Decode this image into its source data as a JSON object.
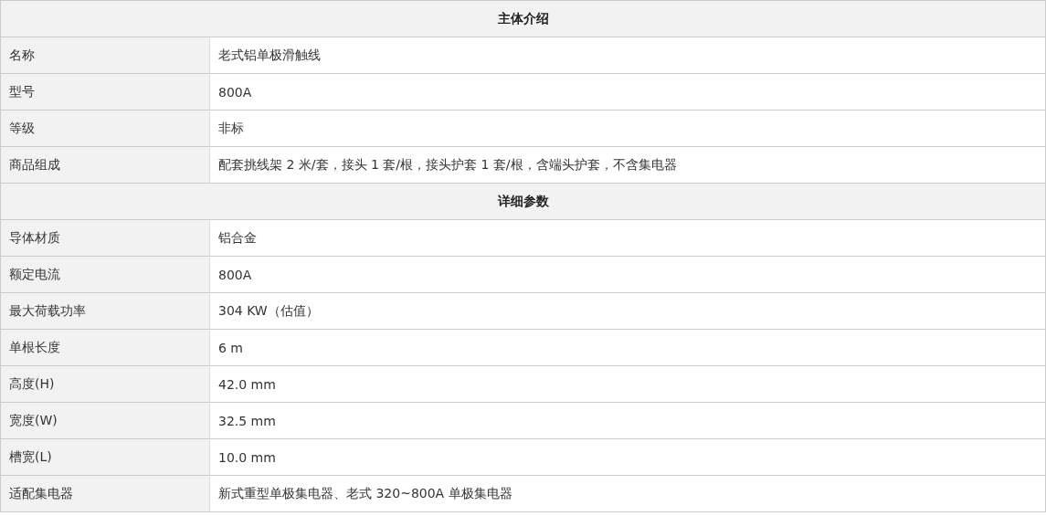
{
  "sections": [
    {
      "title": "主体介绍",
      "rows": [
        {
          "label": "名称",
          "value": "老式铝单极滑触线"
        },
        {
          "label": "型号",
          "value": "800A"
        },
        {
          "label": "等级",
          "value": "非标"
        },
        {
          "label": "商品组成",
          "value": "配套挑线架 2 米/套，接头 1 套/根，接头护套 1 套/根，含端头护套，不含集电器"
        }
      ]
    },
    {
      "title": "详细参数",
      "rows": [
        {
          "label": "导体材质",
          "value": "铝合金"
        },
        {
          "label": "额定电流",
          "value": "800A"
        },
        {
          "label": "最大荷载功率",
          "value": "304 KW（估值）"
        },
        {
          "label": "单根长度",
          "value": "6 m"
        },
        {
          "label": "高度(H)",
          "value": "42.0 mm"
        },
        {
          "label": "宽度(W)",
          "value": "32.5 mm"
        },
        {
          "label": "槽宽(L)",
          "value": "10.0 mm"
        },
        {
          "label": "适配集电器",
          "value": "新式重型单极集电器、老式 320~800A 单极集电器"
        }
      ]
    }
  ]
}
